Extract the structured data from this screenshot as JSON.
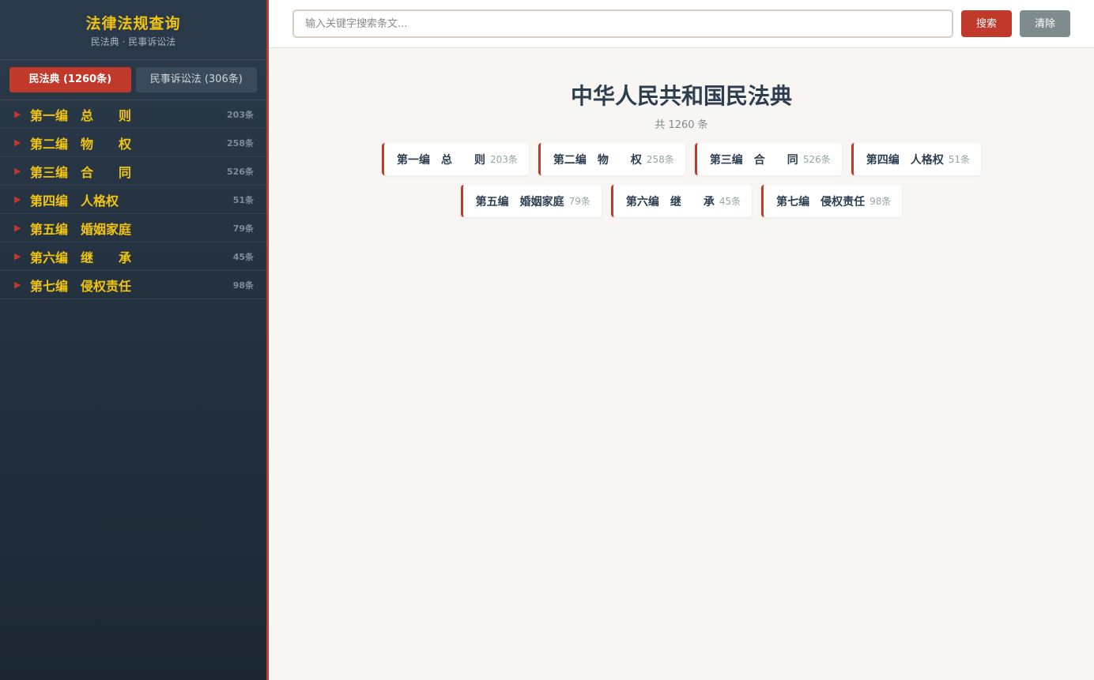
{
  "sidebar": {
    "title": "法律法规查询",
    "subtitle": "民法典 · 民事诉讼法",
    "tabs": [
      {
        "label": "民法典 (1260条)"
      },
      {
        "label": "民事诉讼法 (306条)"
      }
    ],
    "items": [
      {
        "label": "第一编　总　　则",
        "count": "203条"
      },
      {
        "label": "第二编　物　　权",
        "count": "258条"
      },
      {
        "label": "第三编　合　　同",
        "count": "526条"
      },
      {
        "label": "第四编　人格权",
        "count": "51条"
      },
      {
        "label": "第五编　婚姻家庭",
        "count": "79条"
      },
      {
        "label": "第六编　继　　承",
        "count": "45条"
      },
      {
        "label": "第七编　侵权责任",
        "count": "98条"
      }
    ]
  },
  "search": {
    "placeholder": "输入关键字搜索条文...",
    "search_label": "搜索",
    "clear_label": "清除"
  },
  "main": {
    "title": "中华人民共和国民法典",
    "subtitle": "共 1260 条",
    "cards": [
      {
        "label": "第一编　总　　则",
        "count": "203条"
      },
      {
        "label": "第二编　物　　权",
        "count": "258条"
      },
      {
        "label": "第三编　合　　同",
        "count": "526条"
      },
      {
        "label": "第四编　人格权",
        "count": "51条"
      },
      {
        "label": "第五编　婚姻家庭",
        "count": "79条"
      },
      {
        "label": "第六编　继　　承",
        "count": "45条"
      },
      {
        "label": "第七编　侵权责任",
        "count": "98条"
      }
    ]
  },
  "colors": {
    "accent": "#c0392b",
    "gold": "#f1c40f",
    "sidebar_bg": "#2b3a4a",
    "content_bg": "#f8f6f2"
  }
}
